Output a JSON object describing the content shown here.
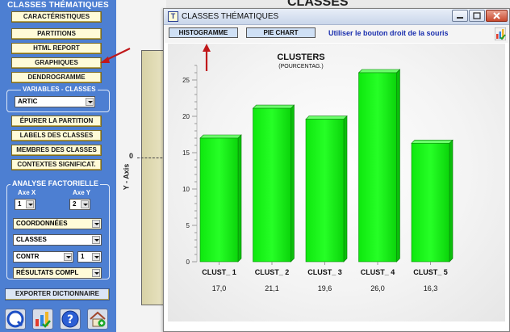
{
  "background": {
    "title": "CLASSES",
    "axis_tick": "0",
    "axis_label": "Y - Axis"
  },
  "sidebar": {
    "heading": "CLASSES THÉMATIQUES",
    "buttons_top": [
      "CARACTÉRISTIQUES",
      "PARTITIONS",
      "HTML REPORT",
      "GRAPHIQUES",
      "DENDROGRAMME"
    ],
    "variables_heading": "VARIABLES - CLASSES",
    "variable_select": "ARTIC",
    "buttons_mid": [
      "ÉPURER LA PARTITION",
      "LABELS DES CLASSES",
      "MEMBRES DES CLASSES",
      "CONTEXTES SIGNIFICAT."
    ],
    "analysis_heading": "ANALYSE FACTORIELLE",
    "axe_x_label": "Axe X",
    "axe_x_value": "1",
    "axe_y_label": "Axe Y",
    "axe_y_value": "2",
    "coords_select": "COORDONNÉES",
    "classes_select": "CLASSES",
    "contr_select": "CONTR",
    "contr_num": "1",
    "results_select": "RÉSULTATS COMPL",
    "export_button": "EXPORTER DICTIONNAIRE",
    "tool_icons": [
      "quit-icon",
      "chart-icon",
      "help-icon",
      "home-icon"
    ]
  },
  "window": {
    "title": "CLASSES THÉMATIQUES",
    "app_icon_letter": "T",
    "controls": [
      "minimize",
      "maximize",
      "close"
    ],
    "tab_histogram": "HISTOGRAMME",
    "tab_pie": "PIE CHART",
    "hint": "Utiliser le bouton droit de la souris"
  },
  "colors": {
    "sidebar_bg": "#4d7fd2",
    "button_bg": "#fffbd8",
    "bar_fill": "#18ff18",
    "hint_text": "#1a2fae",
    "arrow": "#c0181a"
  },
  "chart_data": {
    "type": "bar",
    "title": "CLUSTERS",
    "subtitle": "(POURCENTAG.)",
    "categories": [
      "CLUST_ 1",
      "CLUST_ 2",
      "CLUST_ 3",
      "CLUST_ 4",
      "CLUST_ 5"
    ],
    "values": [
      17.0,
      21.1,
      19.6,
      26.0,
      16.3
    ],
    "value_labels": [
      "17,0",
      "21,1",
      "19,6",
      "26,0",
      "16,3"
    ],
    "yticks": [
      0,
      5,
      10,
      15,
      20,
      25
    ],
    "ylim": [
      0,
      27
    ],
    "xlabel": "",
    "ylabel": "",
    "grid": false,
    "legend": "none"
  }
}
